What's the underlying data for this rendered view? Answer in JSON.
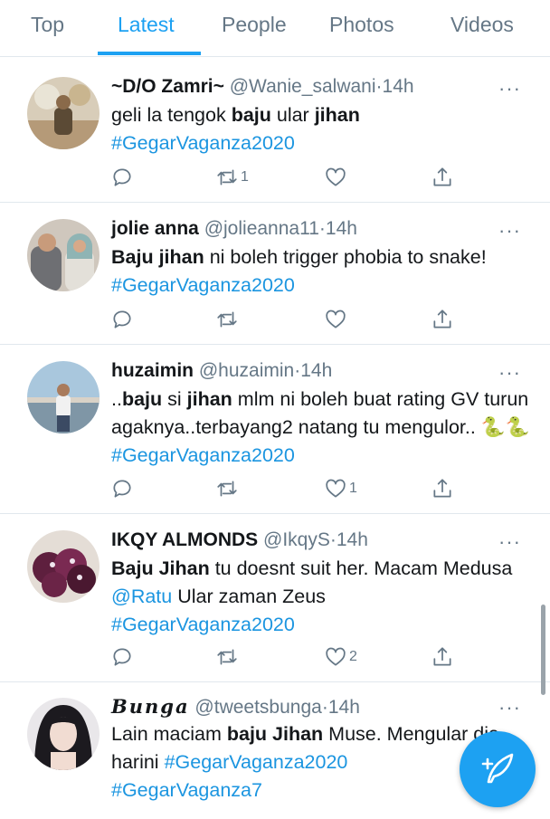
{
  "tabs": [
    {
      "label": "Top",
      "active": false
    },
    {
      "label": "Latest",
      "active": true
    },
    {
      "label": "People",
      "active": false
    },
    {
      "label": "Photos",
      "active": false
    },
    {
      "label": "Videos",
      "active": false
    }
  ],
  "colors": {
    "accent": "#1da1f2",
    "muted": "#657786",
    "divider": "#e1e8ed"
  },
  "tweets": [
    {
      "name": "~D/O Zamri~",
      "handle": "@Wanie_salwani",
      "dot": "·",
      "time": "14h",
      "more": "···",
      "text": {
        "p1": "geli la tengok ",
        "b1": "baju",
        "p2": " ular ",
        "b2": "jihan",
        "tag1": "#GegarVaganza2020"
      },
      "retweets": "1",
      "likes": ""
    },
    {
      "name": "jolie anna",
      "handle": "@jolieanna11",
      "dot": "·",
      "time": "14h",
      "more": "···",
      "text": {
        "b1": "Baju jihan",
        "p1": " ni boleh trigger phobia to snake!",
        "tag1": "#GegarVaganza2020"
      },
      "retweets": "",
      "likes": ""
    },
    {
      "name": "huzaimin",
      "handle": "@huzaimin",
      "dot": "·",
      "time": "14h",
      "more": "···",
      "text": {
        "p1": "..",
        "b1": "baju",
        "p2": " si ",
        "b2": "jihan",
        "p3": " mlm ni boleh buat rating GV turun agaknya..terbayang2 natang tu mengulor.. ",
        "emoji": "🐍🐍",
        "tag1": "#GegarVaganza2020"
      },
      "retweets": "",
      "likes": "1"
    },
    {
      "name": "IKQY ALMONDS",
      "handle": "@IkqyS",
      "dot": "·",
      "time": "14h",
      "more": "···",
      "text": {
        "b1": "Baju Jihan",
        "p1": " tu doesnt suit her. Macam Medusa ",
        "mention": "@Ratu",
        "p2": " Ular zaman Zeus",
        "tag1": "#GegarVaganza2020"
      },
      "retweets": "",
      "likes": "2"
    },
    {
      "name": "Bunga",
      "handle": "@tweetsbunga",
      "dot": "·",
      "time": "14h",
      "more": "···",
      "text": {
        "p1": "Lain maciam ",
        "b1": "baju Jihan",
        "p2": " Muse. Mengular dia harini ",
        "tag1": "#GegarVaganza2020",
        "tag2": "#GegarVaganza7"
      }
    }
  ],
  "fab": {
    "icon": "compose-tweet-icon"
  }
}
